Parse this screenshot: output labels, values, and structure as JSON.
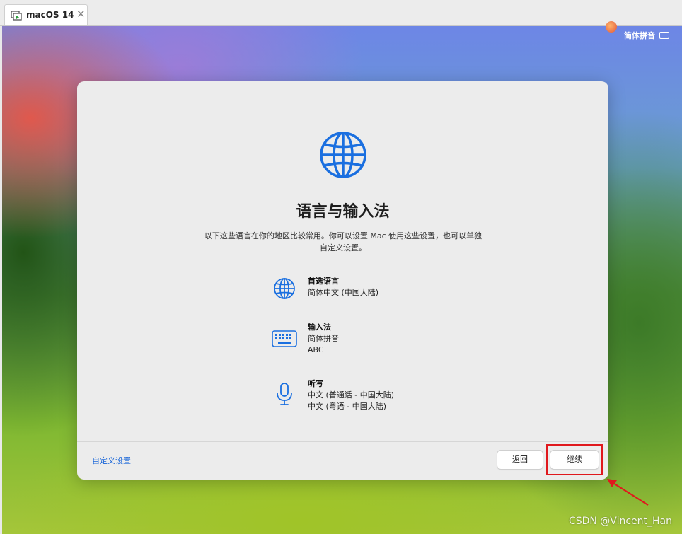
{
  "tab": {
    "title": "macOS 14",
    "close_glyph": "✕",
    "icon": "vm-screen-icon"
  },
  "menubar": {
    "input_method": "简体拼音",
    "keyboard_icon": "keyboard-icon"
  },
  "dialog": {
    "title": "语言与输入法",
    "description": "以下这些语言在你的地区比较常用。你可以设置 Mac 使用这些设置，也可以单独自定义设置。",
    "items": [
      {
        "icon": "globe-icon",
        "title": "首选语言",
        "lines": [
          "简体中文 (中国大陆)"
        ]
      },
      {
        "icon": "keyboard-icon",
        "title": "输入法",
        "lines": [
          "简体拼音",
          "ABC"
        ]
      },
      {
        "icon": "microphone-icon",
        "title": "听写",
        "lines": [
          "中文 (普通话 - 中国大陆)",
          "中文 (粤语 - 中国大陆)"
        ]
      }
    ],
    "custom_link": "自定义设置",
    "back_button": "返回",
    "continue_button": "继续"
  },
  "colors": {
    "accent": "#1a66d8",
    "annotation": "#e0181d"
  },
  "watermark": "CSDN @Vincent_Han"
}
